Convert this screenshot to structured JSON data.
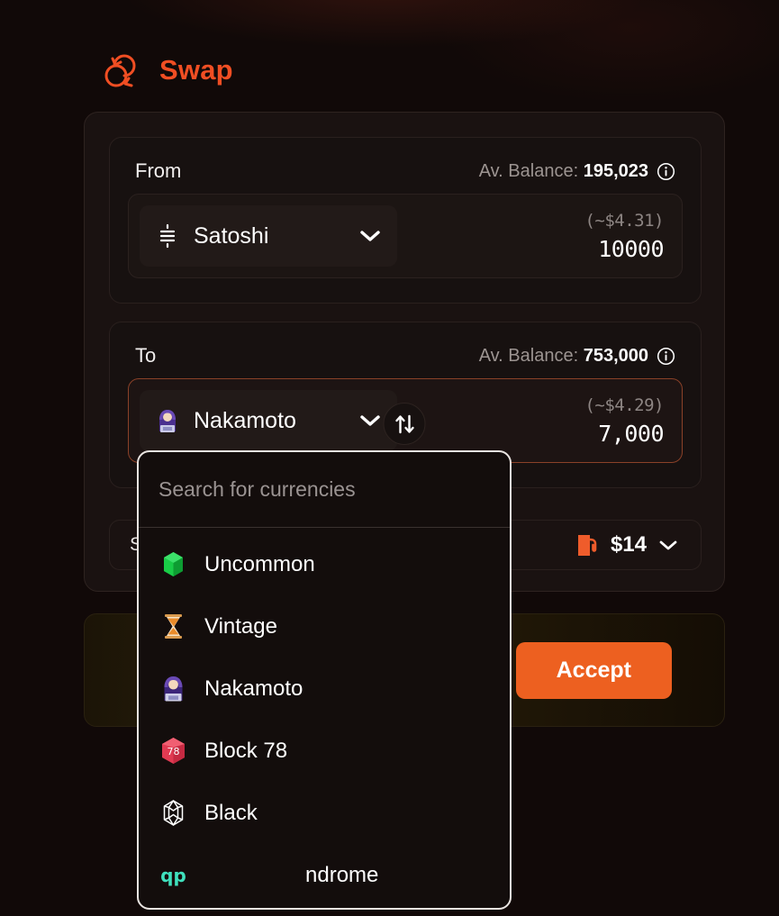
{
  "header": {
    "title": "Swap",
    "logo_icon": "swap-circular-arrows-icon",
    "accent_color": "#F04E23"
  },
  "from_panel": {
    "label": "From",
    "balance_prefix": "Av. Balance:",
    "balance_value": "195,023",
    "info_icon": "info-circle-icon",
    "token": {
      "name": "Satoshi",
      "icon": "satoshi-symbol-icon"
    },
    "usd_approx": "(~$4.31)",
    "amount": "10000",
    "chevron_icon": "chevron-down-icon"
  },
  "to_panel": {
    "label": "To",
    "balance_prefix": "Av. Balance:",
    "balance_value": "753,000",
    "info_icon": "info-circle-icon",
    "token": {
      "name": "Nakamoto",
      "icon": "nakamoto-hooded-figure-icon"
    },
    "usd_approx": "(~$4.29)",
    "amount": "7,000",
    "chevron_icon": "chevron-down-icon",
    "focus_border_color": "#8a4128"
  },
  "swap_toggle": {
    "icon": "swap-vertical-arrows-icon"
  },
  "fee_row": {
    "slippage_label": "S",
    "gas_icon": "gas-pump-icon",
    "gas_amount": "$14",
    "chevron_icon": "chevron-down-icon"
  },
  "accept_bar": {
    "button_label": "Accept",
    "button_color": "#ED6020"
  },
  "currency_dropdown": {
    "search_placeholder": "Search for currencies",
    "search_value": "",
    "items": [
      {
        "label": "Uncommon",
        "icon": "green-gem-icon"
      },
      {
        "label": "Vintage",
        "icon": "hourglass-icon"
      },
      {
        "label": "Nakamoto",
        "icon": "nakamoto-hooded-figure-icon"
      },
      {
        "label": "Block 78",
        "icon": "red-d20-dice-icon"
      },
      {
        "label": "Black",
        "icon": "black-gem-outline-icon"
      },
      {
        "label": "ndrome",
        "icon": "qp-teal-logo-icon"
      }
    ]
  }
}
